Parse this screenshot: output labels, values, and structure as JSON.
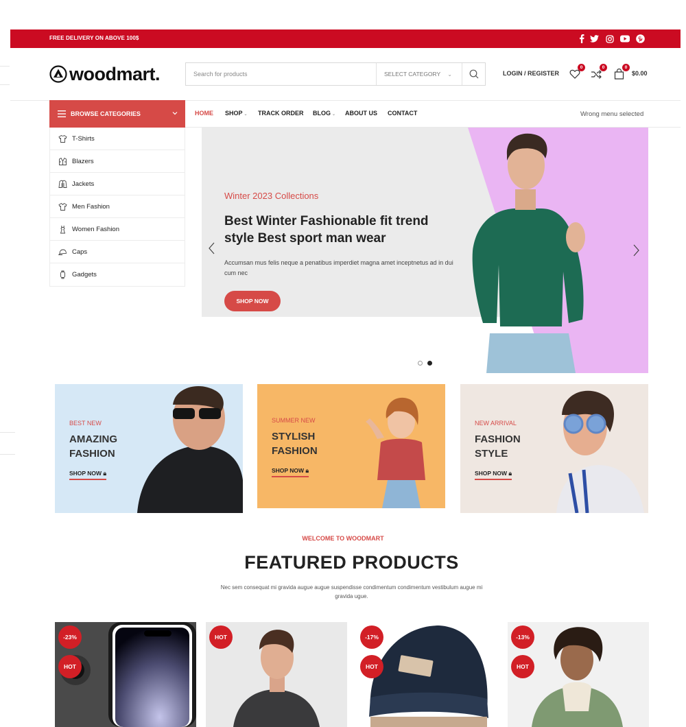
{
  "topbar": {
    "promo_text": "FREE DELIVERY ON ABOVE 100$",
    "social_icons": [
      "facebook-icon",
      "twitter-icon",
      "instagram-icon",
      "youtube-icon",
      "pinterest-icon"
    ]
  },
  "header": {
    "logo_text": "woodmart.",
    "search_placeholder": "Search for products",
    "category_select": "SELECT CATEGORY",
    "login_label": "LOGIN / REGISTER",
    "wishlist_count": "0",
    "compare_count": "0",
    "cart_count": "0",
    "cart_total": "$0.00"
  },
  "nav": {
    "browse_label": "BROWSE CATEGORIES",
    "items": [
      {
        "label": "HOME",
        "active": true
      },
      {
        "label": "SHOP",
        "dropdown": true
      },
      {
        "label": "TRACK ORDER"
      },
      {
        "label": "BLOG",
        "dropdown": true
      },
      {
        "label": "ABOUT US"
      },
      {
        "label": "CONTACT"
      }
    ],
    "right_text": "Wrong menu selected"
  },
  "categories": [
    {
      "label": "T-Shirts",
      "icon": "tshirt-icon"
    },
    {
      "label": "Blazers",
      "icon": "blazer-icon"
    },
    {
      "label": "Jackets",
      "icon": "jacket-icon"
    },
    {
      "label": "Men Fashion",
      "icon": "shirt-icon"
    },
    {
      "label": "Women Fashion",
      "icon": "dress-icon"
    },
    {
      "label": "Caps",
      "icon": "cap-icon"
    },
    {
      "label": "Gadgets",
      "icon": "gadget-icon"
    }
  ],
  "hero": {
    "subtitle": "Winter 2023 Collections",
    "title": "Best Winter Fashionable fit trend style Best sport man wear",
    "description": "Accumsan mus felis neque a penatibus imperdiet magna amet inceptnetus ad in dui cum nec",
    "button": "SHOP NOW",
    "slides": 2,
    "active_slide": 2
  },
  "promos": [
    {
      "subtitle": "BEST NEW",
      "title_line1": "AMAZING",
      "title_line2": "FASHION",
      "link": "SHOP NOW"
    },
    {
      "subtitle": "SUMMER NEW",
      "title_line1": "STYLISH",
      "title_line2": "FASHION",
      "link": "SHOP NOW"
    },
    {
      "subtitle": "NEW ARRIVAL",
      "title_line1": "FASHION",
      "title_line2": "STYLE",
      "link": "SHOP NOW"
    }
  ],
  "featured": {
    "kicker": "WELCOME TO WOODMART",
    "title": "FEATURED PRODUCTS",
    "description": "Nec sem consequat mi gravida augue augue suspendisse condimentum condimentum vestibulum augue mi gravida ugue."
  },
  "products": [
    {
      "badges": [
        "-23%",
        "HOT"
      ]
    },
    {
      "badges": [
        "HOT"
      ]
    },
    {
      "badges": [
        "-17%",
        "HOT"
      ]
    },
    {
      "badges": [
        "-13%",
        "HOT"
      ]
    }
  ],
  "colors": {
    "accent": "#d64a47",
    "topbar": "#cb0b22",
    "badge": "#d21f26"
  }
}
